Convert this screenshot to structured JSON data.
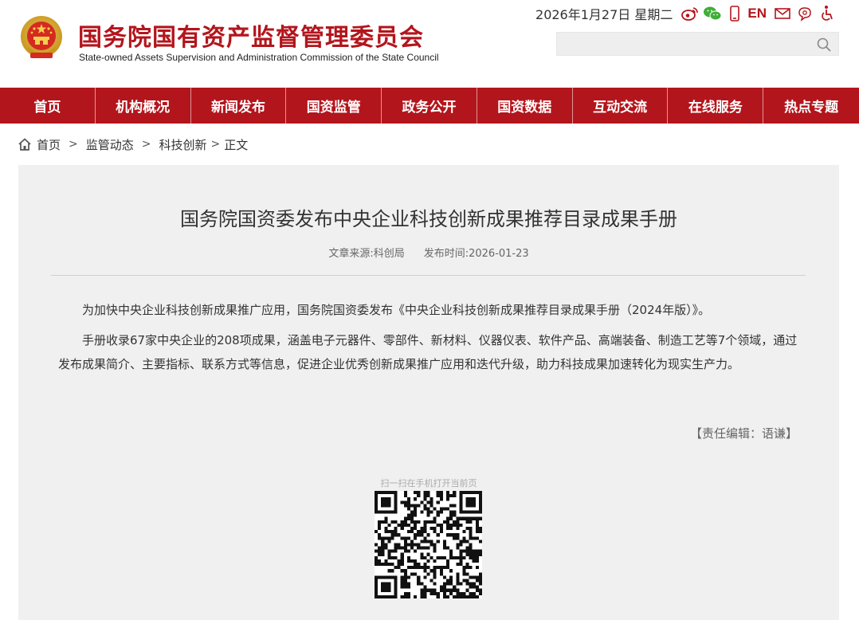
{
  "header": {
    "title": "国务院国有资产监督管理委员会",
    "subtitle": "State-owned Assets Supervision and Administration Commission of the State Council",
    "date": "2026年1月27日 星期二",
    "lang_label": "EN",
    "icons": [
      "weibo-icon",
      "wechat-icon",
      "mobile-icon",
      "en-link",
      "mail-icon",
      "message-icon",
      "accessibility-icon"
    ],
    "search_placeholder": ""
  },
  "nav": {
    "items": [
      {
        "label": "首页"
      },
      {
        "label": "机构概况"
      },
      {
        "label": "新闻发布"
      },
      {
        "label": "国资监管"
      },
      {
        "label": "政务公开"
      },
      {
        "label": "国资数据"
      },
      {
        "label": "互动交流"
      },
      {
        "label": "在线服务"
      },
      {
        "label": "热点专题"
      }
    ]
  },
  "breadcrumb": {
    "home": "首页",
    "sep": ">",
    "level1": "监管动态",
    "level2": "科技创新",
    "current": "正文"
  },
  "article": {
    "title": "国务院国资委发布中央企业科技创新成果推荐目录成果手册",
    "source_label": "文章来源:",
    "source": "科创局",
    "time_label": "发布时间:",
    "time": "2026-01-23",
    "paragraphs": [
      "为加快中央企业科技创新成果推广应用，国务院国资委发布《中央企业科技创新成果推荐目录成果手册（2024年版）》。",
      "手册收录67家中央企业的208项成果，涵盖电子元器件、零部件、新材料、仪器仪表、软件产品、高端装备、制造工艺等7个领域，通过发布成果简介、主要指标、联系方式等信息，促进企业优秀创新成果推广应用和迭代升级，助力科技成果加速转化为现实生产力。"
    ],
    "editor": "【责任编辑：语谦】",
    "qr_caption": "扫一扫在手机打开当前页"
  },
  "colors": {
    "brand_red": "#b3151c",
    "panel_bg": "#f0f0f0"
  }
}
